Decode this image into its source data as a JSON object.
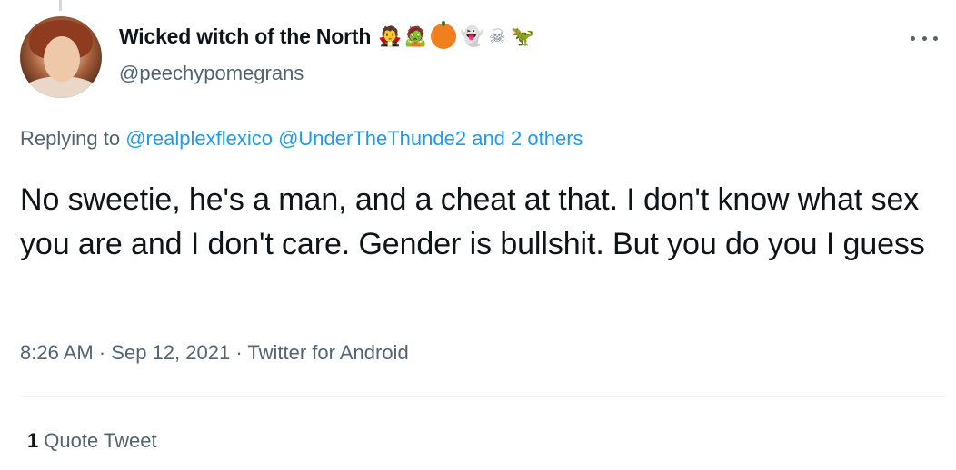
{
  "tweet": {
    "display_name": "Wicked witch of the North",
    "name_emojis": [
      "vampire-woman-icon",
      "zombie-woman-icon",
      "jack-o-lantern-icon",
      "ghost-icon",
      "skull-crossbones-icon",
      "t-rex-icon"
    ],
    "emoji_glyphs": {
      "vampire": "🧛",
      "zombie": "🧟",
      "ghost": "👻",
      "skull": "☠",
      "trex": "🦖"
    },
    "handle": "@peechypomegrans",
    "replying_prefix": "Replying to",
    "reply_mention_1": "@realplexflexico",
    "reply_mention_2": "@UnderTheThunde2",
    "reply_others": "and 2 others",
    "text": "No sweetie, he's a man, and a cheat at that. I don't know what sex you are and I don't care. Gender is bullshit. But you do you I guess",
    "time": "8:26 AM",
    "date": "Sep 12, 2021",
    "source": "Twitter for Android",
    "separator": "·",
    "quote_count": "1",
    "quote_label": "Quote Tweet"
  },
  "colors": {
    "text_primary": "#0f1419",
    "text_secondary": "#536471",
    "link": "#1d9bf0",
    "divider": "#eff3f4"
  }
}
